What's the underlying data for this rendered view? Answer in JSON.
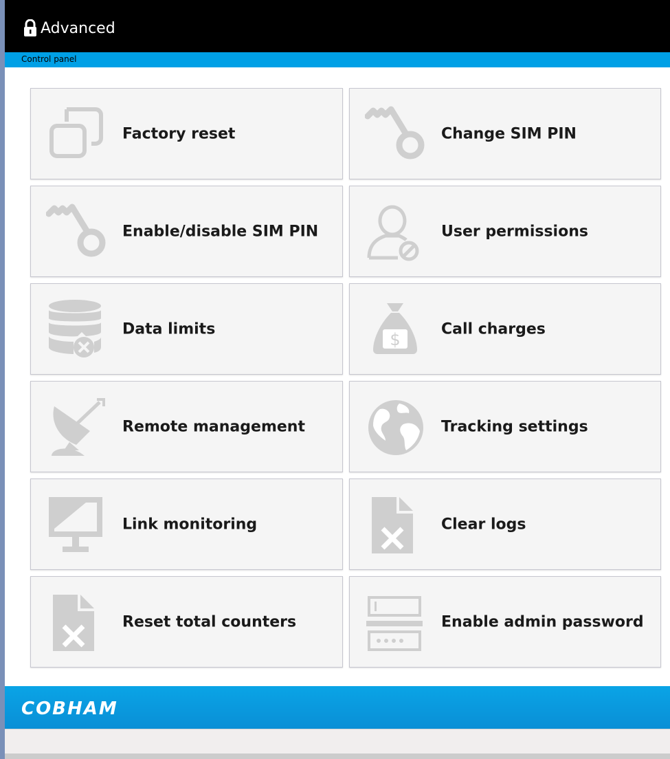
{
  "header": {
    "title": "Advanced",
    "icon": "lock-icon"
  },
  "subbar": {
    "breadcrumb": "Control panel"
  },
  "tiles": [
    {
      "label": "Factory reset",
      "icon": "factory-reset-icon"
    },
    {
      "label": "Change SIM PIN",
      "icon": "key-icon"
    },
    {
      "label": "Enable/disable SIM PIN",
      "icon": "key-icon"
    },
    {
      "label": "User permissions",
      "icon": "user-permissions-icon"
    },
    {
      "label": "Data limits",
      "icon": "database-x-icon"
    },
    {
      "label": "Call charges",
      "icon": "money-bag-icon"
    },
    {
      "label": "Remote management",
      "icon": "satellite-dish-icon"
    },
    {
      "label": "Tracking settings",
      "icon": "globe-icon"
    },
    {
      "label": "Link monitoring",
      "icon": "monitor-icon"
    },
    {
      "label": "Clear logs",
      "icon": "document-x-icon"
    },
    {
      "label": "Reset total counters",
      "icon": "document-x-icon"
    },
    {
      "label": "Enable admin password",
      "icon": "password-field-icon"
    }
  ],
  "footer": {
    "brand": "COBHAM"
  },
  "colors": {
    "header_bg": "#000000",
    "accent": "#00a0e6",
    "tile_bg": "#f5f5f5",
    "icon_gray": "#cfcfcf"
  }
}
